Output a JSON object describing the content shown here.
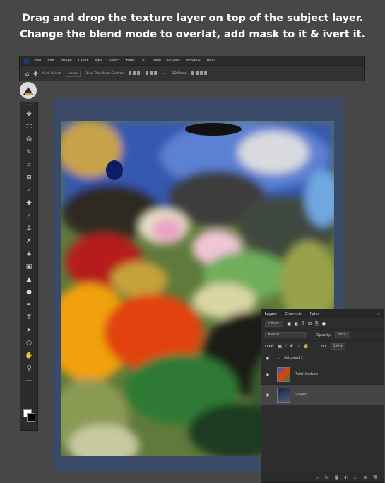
{
  "caption": {
    "line1": "Drag and drop the texture layer on top of the subject layer.",
    "line2": "Change the blend mode to overlat, add mask to it & ivert it."
  },
  "menu": [
    "File",
    "Edit",
    "Image",
    "Layer",
    "Type",
    "Select",
    "Filter",
    "3D",
    "View",
    "Plugins",
    "Window",
    "Help"
  ],
  "options": {
    "auto_select": "Auto-Select:",
    "layer_select": "Layer",
    "transform": "Show Transform Controls",
    "mode_3d": "3D Mode:"
  },
  "layers_panel": {
    "tabs": [
      "Layers",
      "Channels",
      "Paths"
    ],
    "kind": "Kind",
    "blend_mode": "Normal",
    "opacity_label": "Opacity:",
    "opacity_value": "100%",
    "lock_label": "Lock:",
    "fill_label": "Fill:",
    "fill_value": "100%",
    "artboard": "Artboard 1",
    "layers": [
      {
        "name": "Paint_texture"
      },
      {
        "name": "Subject"
      }
    ]
  },
  "icons": {
    "tools": [
      "move",
      "marquee",
      "lasso",
      "quick-select",
      "crop",
      "frame",
      "eyedropper",
      "healing",
      "brush",
      "stamp",
      "history-brush",
      "eraser",
      "gradient",
      "blur",
      "dodge",
      "pen",
      "type",
      "path-select",
      "shape",
      "hand",
      "zoom",
      "more"
    ]
  }
}
